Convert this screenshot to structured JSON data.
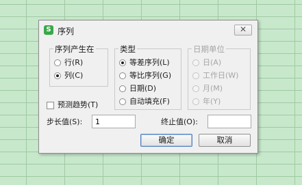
{
  "dialog": {
    "title": "序列",
    "app_icon_letter": "S",
    "close_symbol": "✕"
  },
  "series_in": {
    "label": "序列产生在",
    "options": [
      {
        "label": "行(R)",
        "selected": false
      },
      {
        "label": "列(C)",
        "selected": true
      }
    ]
  },
  "type": {
    "label": "类型",
    "options": [
      {
        "label": "等差序列(L)",
        "selected": true
      },
      {
        "label": "等比序列(G)",
        "selected": false
      },
      {
        "label": "日期(D)",
        "selected": false
      },
      {
        "label": "自动填充(F)",
        "selected": false
      }
    ]
  },
  "date_unit": {
    "label": "日期单位",
    "disabled": true,
    "options": [
      {
        "label": "日(A)",
        "selected": true
      },
      {
        "label": "工作日(W)",
        "selected": false
      },
      {
        "label": "月(M)",
        "selected": false
      },
      {
        "label": "年(Y)",
        "selected": false
      }
    ]
  },
  "trend": {
    "label": "预测趋势(T)",
    "checked": false
  },
  "step": {
    "label": "步长值(S):",
    "value": "1"
  },
  "stop": {
    "label": "终止值(O):",
    "value": ""
  },
  "buttons": {
    "ok": "确定",
    "cancel": "取消"
  },
  "highlight_color": "#2ea336"
}
